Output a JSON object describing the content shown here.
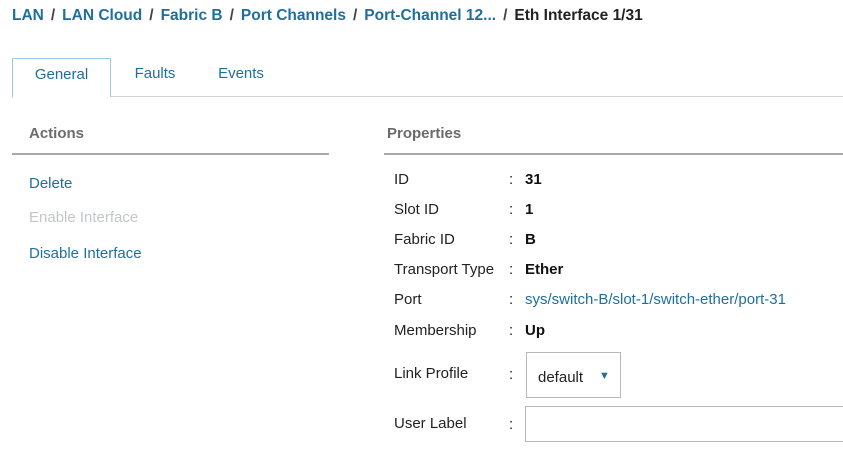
{
  "breadcrumb": {
    "items": [
      "LAN",
      "LAN Cloud",
      "Fabric B",
      "Port Channels",
      "Port-Channel 12...",
      "Eth Interface 1/31"
    ],
    "separator": "/"
  },
  "tabs": [
    {
      "label": "General",
      "active": true
    },
    {
      "label": "Faults",
      "active": false
    },
    {
      "label": "Events",
      "active": false
    }
  ],
  "actions": {
    "title": "Actions",
    "items": [
      {
        "label": "Delete",
        "enabled": true
      },
      {
        "label": "Enable Interface",
        "enabled": false
      },
      {
        "label": "Disable Interface",
        "enabled": true
      }
    ]
  },
  "properties": {
    "title": "Properties",
    "items": [
      {
        "label": "ID",
        "value": "31"
      },
      {
        "label": "Slot ID",
        "value": "1"
      },
      {
        "label": "Fabric ID",
        "value": "B"
      },
      {
        "label": "Transport Type",
        "value": "Ether"
      },
      {
        "label": "Port",
        "value": "sys/switch-B/slot-1/switch-ether/port-31"
      },
      {
        "label": "Membership",
        "value": "Up"
      }
    ],
    "link_profile": {
      "label": "Link Profile",
      "value": "default"
    },
    "user_label": {
      "label": "User Label",
      "value": ""
    },
    "colon": ":"
  },
  "colors": {
    "link": "#1f6f9c",
    "disabled": "#c3c7ca",
    "tab_border": "#9cc9de"
  }
}
